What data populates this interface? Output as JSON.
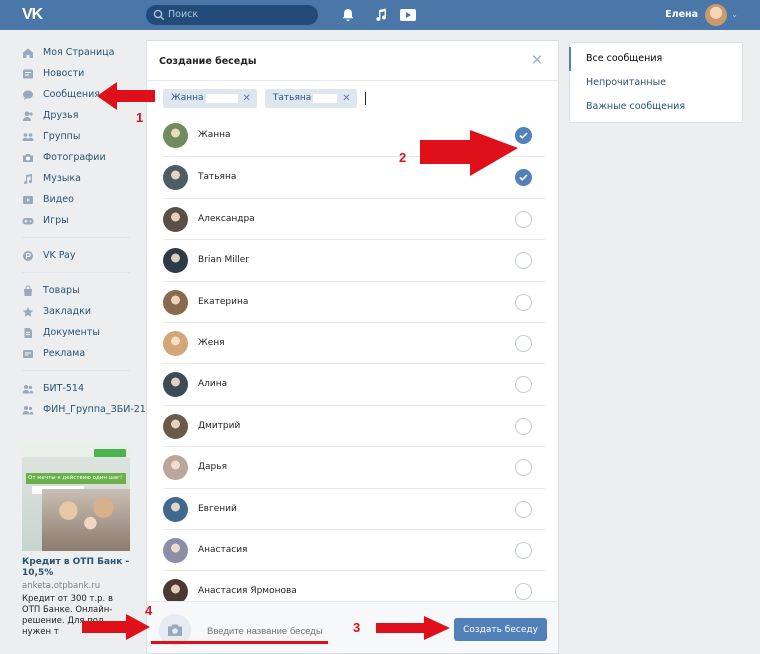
{
  "topbar": {
    "logo": "VK",
    "search_placeholder": "Поиск",
    "user_name": "Елена"
  },
  "sidebar": {
    "items": [
      {
        "label": "Моя Страница",
        "icon": "home-icon"
      },
      {
        "label": "Новости",
        "icon": "news-icon"
      },
      {
        "label": "Сообщения",
        "icon": "messages-icon"
      },
      {
        "label": "Друзья",
        "icon": "friends-icon"
      },
      {
        "label": "Группы",
        "icon": "groups-icon"
      },
      {
        "label": "Фотографии",
        "icon": "camera-icon"
      },
      {
        "label": "Музыка",
        "icon": "music-icon"
      },
      {
        "label": "Видео",
        "icon": "video-icon"
      },
      {
        "label": "Игры",
        "icon": "gamepad-icon"
      }
    ],
    "pay": {
      "label": "VK Pay",
      "icon": "vkpay-icon"
    },
    "items2": [
      {
        "label": "Товары",
        "icon": "bag-icon"
      },
      {
        "label": "Закладки",
        "icon": "star-icon"
      },
      {
        "label": "Документы",
        "icon": "document-icon"
      },
      {
        "label": "Реклама",
        "icon": "ads-icon"
      }
    ],
    "groups": [
      {
        "label": "БИТ-514",
        "icon": "group-chat-icon"
      },
      {
        "label": "ФИН_Группа_ЗБИ-21",
        "icon": "group-chat-icon"
      }
    ]
  },
  "ad": {
    "title": "Кредит в ОТП Банк - 10,5%",
    "domain": "anketa.otpbank.ru",
    "text": "Кредит от 300 т.р. в ОТП Банке. Онлайн-решение. Для пол нужен т",
    "banner_line": "От мечты к действию один шаг!"
  },
  "modal": {
    "title": "Создание беседы",
    "chips": [
      {
        "label": "Жанна"
      },
      {
        "label": "Татьяна"
      }
    ],
    "contacts": [
      {
        "name": "Жанна",
        "checked": true,
        "color": "#6f8c5a"
      },
      {
        "name": "Татьяна",
        "checked": true,
        "color": "#4c5e63"
      },
      {
        "name": "Александра",
        "checked": false,
        "color": "#5b5046"
      },
      {
        "name": "Brian Miller",
        "checked": false,
        "color": "#2f3a48"
      },
      {
        "name": "Екатерина",
        "checked": false,
        "color": "#8a6a4c"
      },
      {
        "name": "Женя",
        "checked": false,
        "color": "#d2a77a"
      },
      {
        "name": "Алина",
        "checked": false,
        "color": "#3d4a57"
      },
      {
        "name": "Дмитрий",
        "checked": false,
        "color": "#6a5a4a"
      },
      {
        "name": "Дарья",
        "checked": false,
        "color": "#b9a79a"
      },
      {
        "name": "Евгений",
        "checked": false,
        "color": "#3f6a8e"
      },
      {
        "name": "Анастасия",
        "checked": false,
        "color": "#8b8ea6"
      },
      {
        "name": "Анастасия Ярмонова",
        "checked": false,
        "color": "#4a3a33"
      }
    ],
    "name_placeholder": "Введите название беседы",
    "create_label": "Создать беседу"
  },
  "right_menu": {
    "items": [
      {
        "label": "Все сообщения",
        "active": true
      },
      {
        "label": "Непрочитанные",
        "active": false
      },
      {
        "label": "Важные сообщения",
        "active": false
      }
    ]
  },
  "annotations": {
    "marks": [
      "1",
      "2",
      "3",
      "4"
    ],
    "color": "#e0101b"
  }
}
